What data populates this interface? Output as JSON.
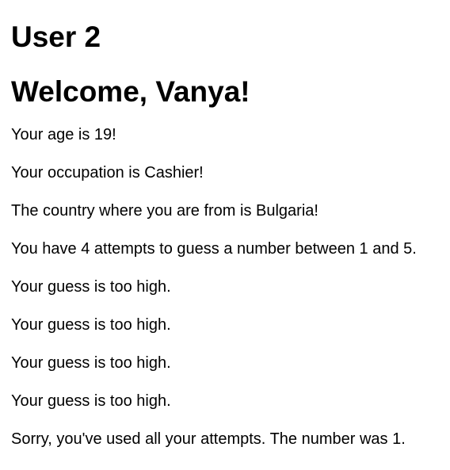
{
  "user_heading": "User 2",
  "welcome_heading": "Welcome, Vanya!",
  "lines": [
    "Your age is 19!",
    "Your occupation is Cashier!",
    "The country where you are from is Bulgaria!",
    "You have 4 attempts to guess a number between 1 and 5.",
    "Your guess is too high.",
    "Your guess is too high.",
    "Your guess is too high.",
    "Your guess is too high.",
    "Sorry, you've used all your attempts. The number was 1."
  ]
}
